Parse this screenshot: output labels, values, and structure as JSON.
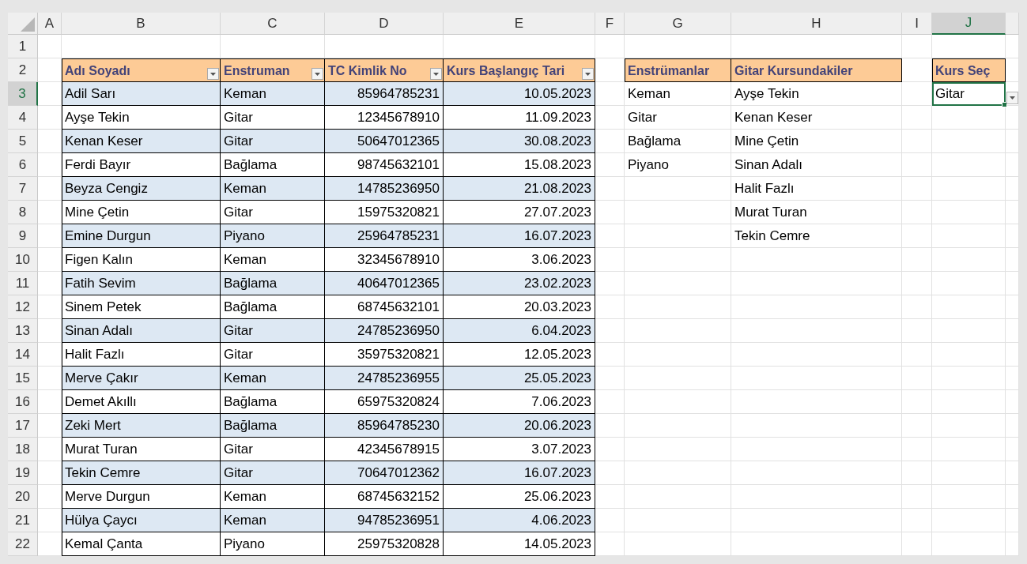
{
  "column_headers": [
    {
      "label": "A",
      "selected": false
    },
    {
      "label": "B",
      "selected": false
    },
    {
      "label": "C",
      "selected": false
    },
    {
      "label": "D",
      "selected": false
    },
    {
      "label": "E",
      "selected": false
    },
    {
      "label": "F",
      "selected": false
    },
    {
      "label": "G",
      "selected": false
    },
    {
      "label": "H",
      "selected": false
    },
    {
      "label": "I",
      "selected": false
    },
    {
      "label": "J",
      "selected": true
    }
  ],
  "row_headers": [
    {
      "label": "1",
      "selected": false
    },
    {
      "label": "2",
      "selected": false
    },
    {
      "label": "3",
      "selected": true
    },
    {
      "label": "4",
      "selected": false
    },
    {
      "label": "5",
      "selected": false
    },
    {
      "label": "6",
      "selected": false
    },
    {
      "label": "7",
      "selected": false
    },
    {
      "label": "8",
      "selected": false
    },
    {
      "label": "9",
      "selected": false
    },
    {
      "label": "10",
      "selected": false
    },
    {
      "label": "11",
      "selected": false
    },
    {
      "label": "12",
      "selected": false
    },
    {
      "label": "13",
      "selected": false
    },
    {
      "label": "14",
      "selected": false
    },
    {
      "label": "15",
      "selected": false
    },
    {
      "label": "16",
      "selected": false
    },
    {
      "label": "17",
      "selected": false
    },
    {
      "label": "18",
      "selected": false
    },
    {
      "label": "19",
      "selected": false
    },
    {
      "label": "20",
      "selected": false
    },
    {
      "label": "21",
      "selected": false
    },
    {
      "label": "22",
      "selected": false
    }
  ],
  "student_table": {
    "columns": [
      "Adı Soyadı",
      "Enstruman",
      "TC Kimlik No",
      "Kurs Başlangıç Tari"
    ],
    "rows": [
      [
        "Adil Sarı",
        "Keman",
        "85964785231",
        "10.05.2023"
      ],
      [
        "Ayşe Tekin",
        "Gitar",
        "12345678910",
        "11.09.2023"
      ],
      [
        "Kenan Keser",
        "Gitar",
        "50647012365",
        "30.08.2023"
      ],
      [
        "Ferdi Bayır",
        "Bağlama",
        "98745632101",
        "15.08.2023"
      ],
      [
        "Beyza Cengiz",
        "Keman",
        "14785236950",
        "21.08.2023"
      ],
      [
        "Mine Çetin",
        "Gitar",
        "15975320821",
        "27.07.2023"
      ],
      [
        "Emine Durgun",
        "Piyano",
        "25964785231",
        "16.07.2023"
      ],
      [
        "Figen Kalın",
        "Keman",
        "32345678910",
        "3.06.2023"
      ],
      [
        "Fatih Sevim",
        "Bağlama",
        "40647012365",
        "23.02.2023"
      ],
      [
        "Sinem Petek",
        "Bağlama",
        "68745632101",
        "20.03.2023"
      ],
      [
        "Sinan Adalı",
        "Gitar",
        "24785236950",
        "6.04.2023"
      ],
      [
        "Halit Fazlı",
        "Gitar",
        "35975320821",
        "12.05.2023"
      ],
      [
        "Merve Çakır",
        "Keman",
        "24785236955",
        "25.05.2023"
      ],
      [
        "Demet Akıllı",
        "Bağlama",
        "65975320824",
        "7.06.2023"
      ],
      [
        "Zeki Mert",
        "Bağlama",
        "85964785230",
        "20.06.2023"
      ],
      [
        "Murat Turan",
        "Gitar",
        "42345678915",
        "3.07.2023"
      ],
      [
        "Tekin Cemre",
        "Gitar",
        "70647012362",
        "16.07.2023"
      ],
      [
        "Merve Durgun",
        "Keman",
        "68745632152",
        "25.06.2023"
      ],
      [
        "Hülya Çaycı",
        "Keman",
        "94785236951",
        "4.06.2023"
      ],
      [
        "Kemal Çanta",
        "Piyano",
        "25975320828",
        "14.05.2023"
      ]
    ]
  },
  "instrument_table": {
    "header": "Enstrümanlar",
    "rows": [
      "Keman",
      "Gitar",
      "Bağlama",
      "Piyano"
    ]
  },
  "result_table": {
    "header": "Gitar Kursundakiler",
    "rows": [
      "Ayşe Tekin",
      "Kenan Keser",
      "Mine Çetin",
      "Sinan Adalı",
      "Halit Fazlı",
      "Murat Turan",
      "Tekin Cemre"
    ]
  },
  "course_select": {
    "header": "Kurs Seç",
    "value": "Gitar"
  }
}
